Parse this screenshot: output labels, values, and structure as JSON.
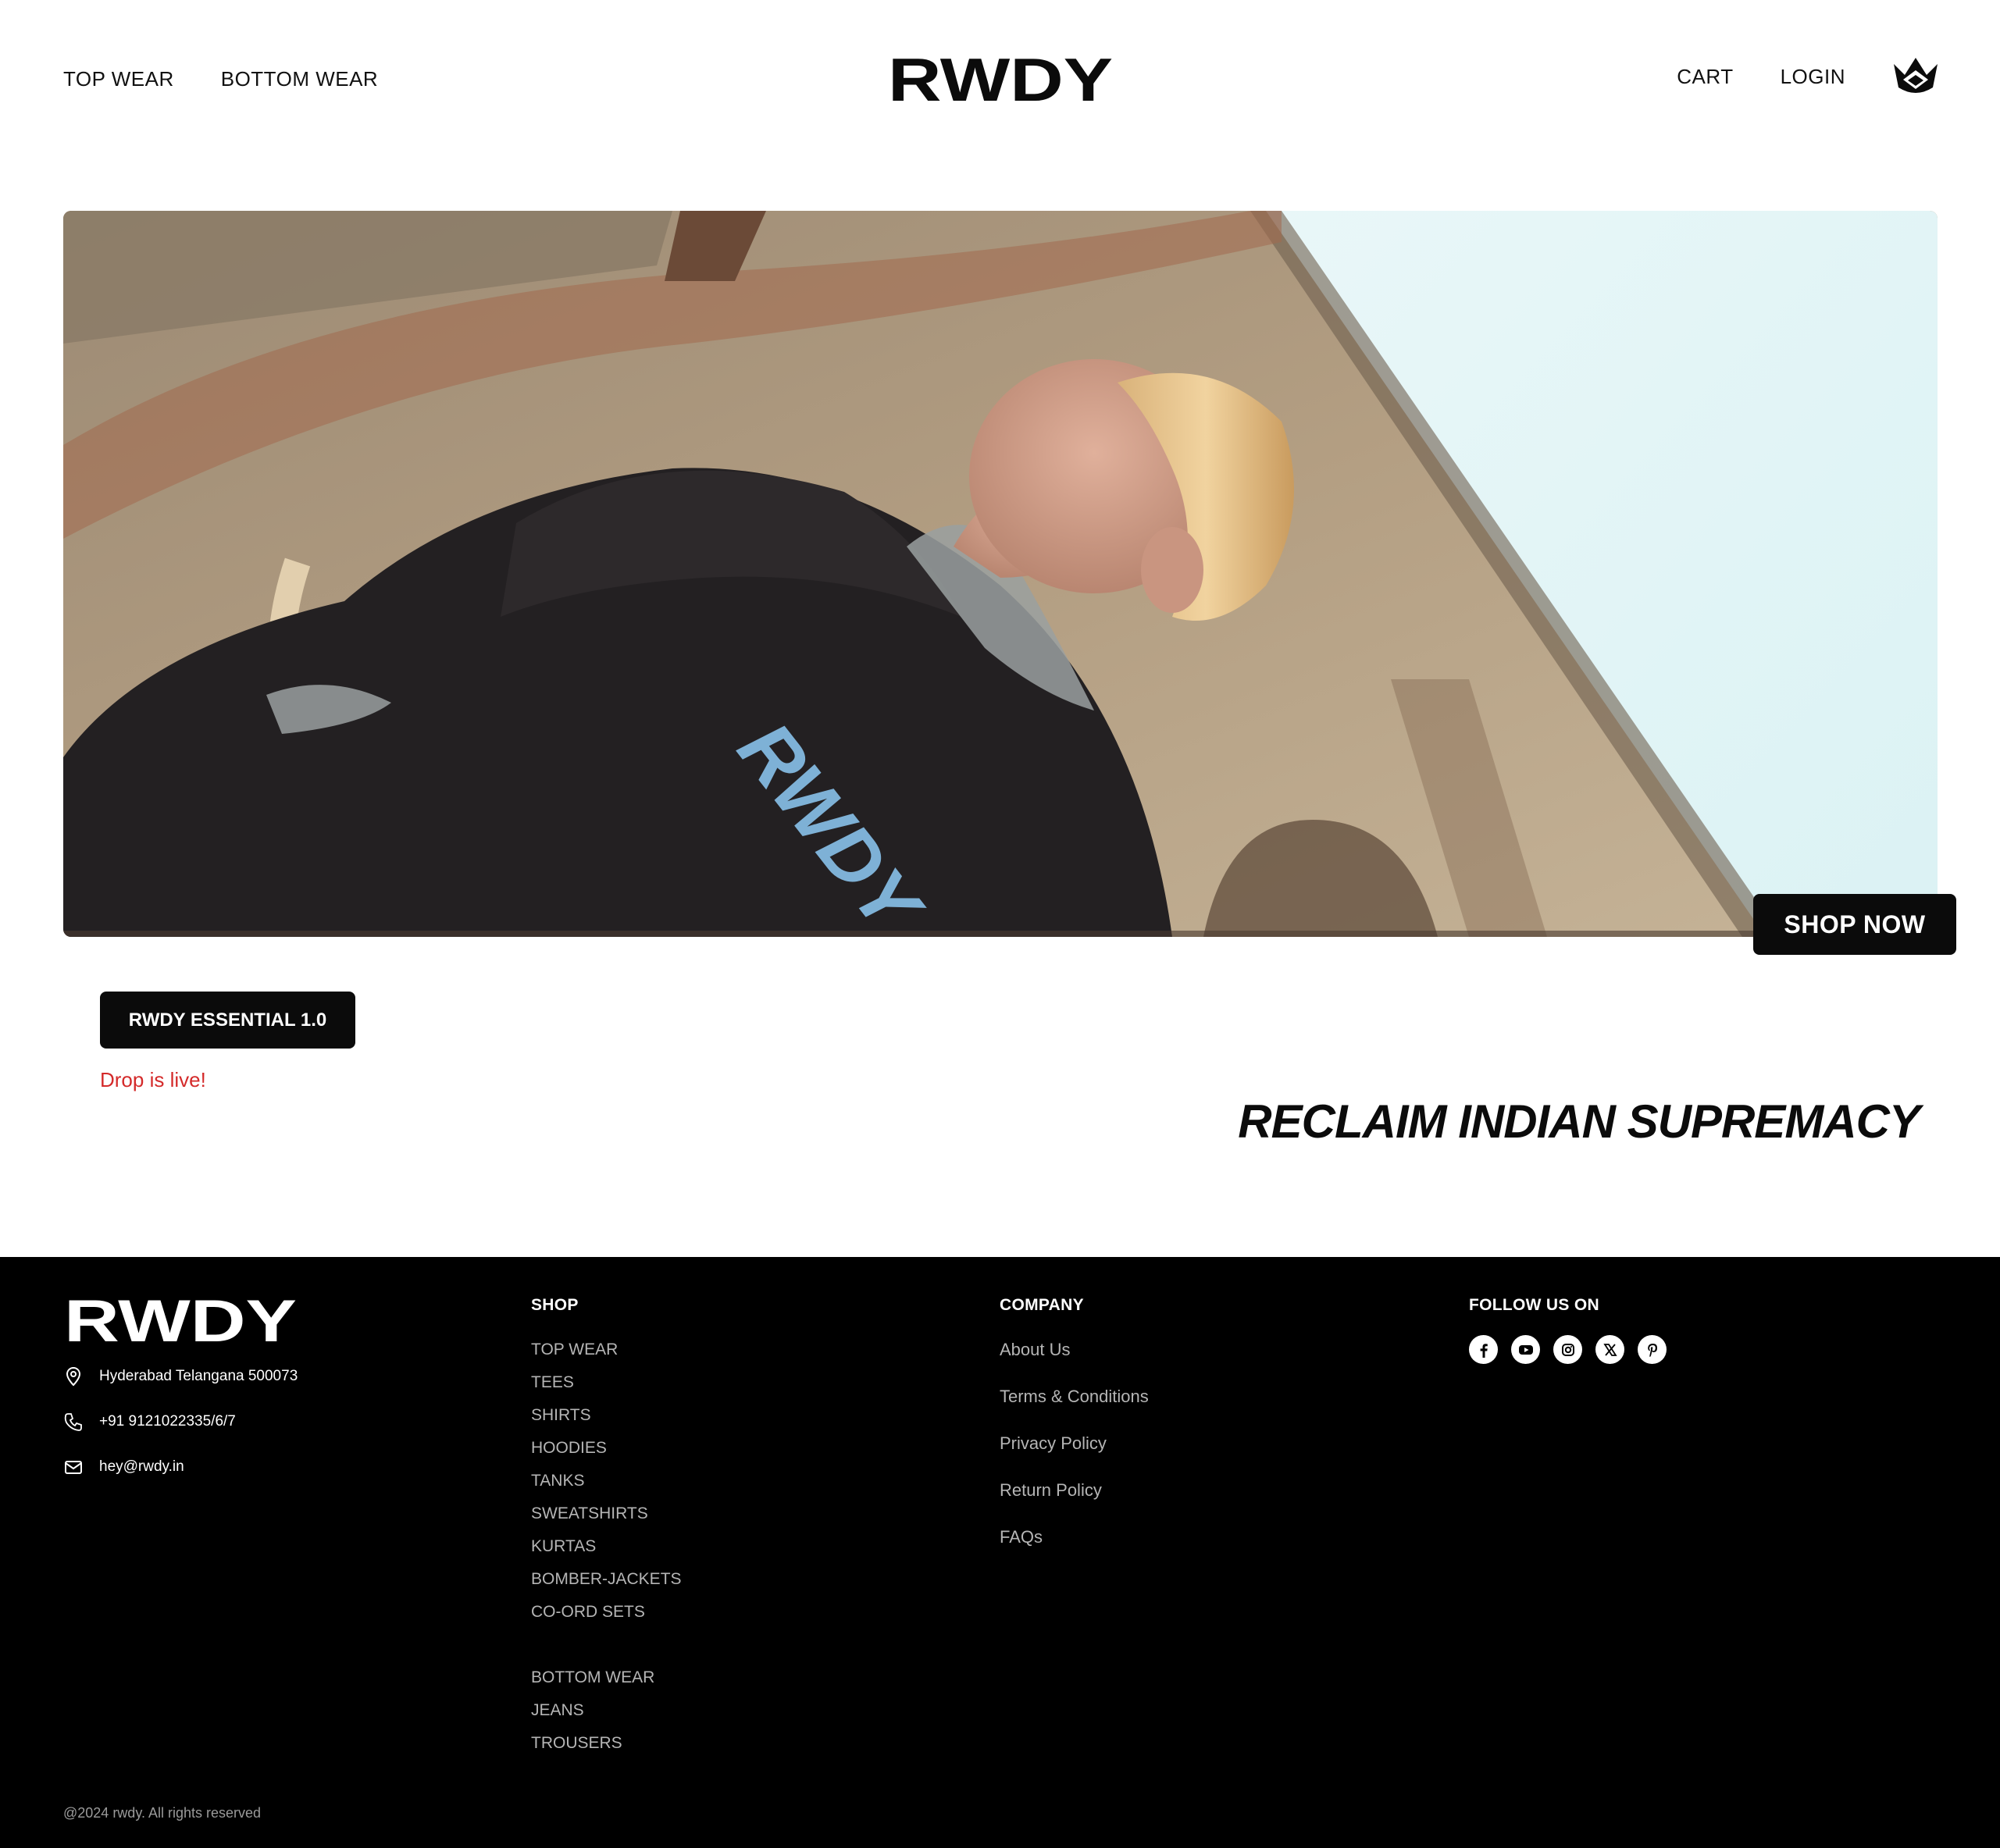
{
  "header": {
    "nav_left": [
      "TOP WEAR",
      "BOTTOM WEAR"
    ],
    "logo_text": "RWDY",
    "nav_right": [
      "CART",
      "LOGIN"
    ],
    "crown_icon": "crown-icon"
  },
  "hero": {
    "shop_now": "SHOP NOW",
    "essential_button": "RWDY ESSENTIAL 1.0",
    "drop_status": "Drop is live!",
    "tagline": "RECLAIM INDIAN SUPREMACY",
    "shirt_print": "RWDY"
  },
  "footer": {
    "logo_text": "RWDY",
    "contact": {
      "address": "Hyderabad Telangana 500073",
      "phone": "+91 9121022335/6/7",
      "email": "hey@rwdy.in"
    },
    "shop": {
      "heading": "SHOP",
      "top_items": [
        "TOP WEAR",
        "TEES",
        "SHIRTS",
        "HOODIES",
        "TANKS",
        "SWEATSHIRTS",
        "KURTAS",
        "BOMBER-JACKETS",
        "CO-ORD SETS"
      ],
      "bottom_items": [
        "BOTTOM WEAR",
        "JEANS",
        "TROUSERS"
      ]
    },
    "company": {
      "heading": "COMPANY",
      "items": [
        "About Us",
        "Terms & Conditions",
        "Privacy Policy",
        "Return Policy",
        "FAQs"
      ]
    },
    "follow": {
      "heading": "FOLLOW US ON",
      "icons": [
        "facebook-icon",
        "youtube-icon",
        "instagram-icon",
        "x-icon",
        "pinterest-icon"
      ]
    },
    "copyright": "@2024 rwdy. All rights reserved"
  },
  "colors": {
    "black": "#0b0b0b",
    "drop_red": "#d42a2a",
    "footer_link": "#b5b5b5",
    "shirt_print_blue": "#7eb1d6"
  }
}
